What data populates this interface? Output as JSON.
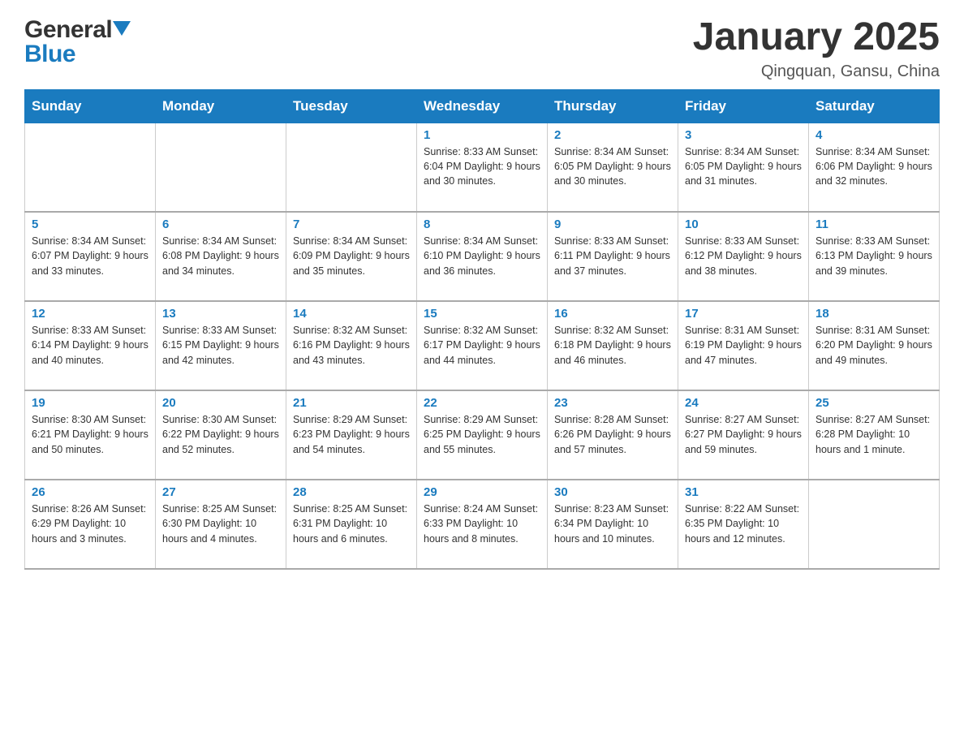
{
  "header": {
    "logo_general": "General",
    "logo_blue": "Blue",
    "title": "January 2025",
    "subtitle": "Qingquan, Gansu, China"
  },
  "days_of_week": [
    "Sunday",
    "Monday",
    "Tuesday",
    "Wednesday",
    "Thursday",
    "Friday",
    "Saturday"
  ],
  "weeks": [
    [
      {
        "day": "",
        "info": ""
      },
      {
        "day": "",
        "info": ""
      },
      {
        "day": "",
        "info": ""
      },
      {
        "day": "1",
        "info": "Sunrise: 8:33 AM\nSunset: 6:04 PM\nDaylight: 9 hours\nand 30 minutes."
      },
      {
        "day": "2",
        "info": "Sunrise: 8:34 AM\nSunset: 6:05 PM\nDaylight: 9 hours\nand 30 minutes."
      },
      {
        "day": "3",
        "info": "Sunrise: 8:34 AM\nSunset: 6:05 PM\nDaylight: 9 hours\nand 31 minutes."
      },
      {
        "day": "4",
        "info": "Sunrise: 8:34 AM\nSunset: 6:06 PM\nDaylight: 9 hours\nand 32 minutes."
      }
    ],
    [
      {
        "day": "5",
        "info": "Sunrise: 8:34 AM\nSunset: 6:07 PM\nDaylight: 9 hours\nand 33 minutes."
      },
      {
        "day": "6",
        "info": "Sunrise: 8:34 AM\nSunset: 6:08 PM\nDaylight: 9 hours\nand 34 minutes."
      },
      {
        "day": "7",
        "info": "Sunrise: 8:34 AM\nSunset: 6:09 PM\nDaylight: 9 hours\nand 35 minutes."
      },
      {
        "day": "8",
        "info": "Sunrise: 8:34 AM\nSunset: 6:10 PM\nDaylight: 9 hours\nand 36 minutes."
      },
      {
        "day": "9",
        "info": "Sunrise: 8:33 AM\nSunset: 6:11 PM\nDaylight: 9 hours\nand 37 minutes."
      },
      {
        "day": "10",
        "info": "Sunrise: 8:33 AM\nSunset: 6:12 PM\nDaylight: 9 hours\nand 38 minutes."
      },
      {
        "day": "11",
        "info": "Sunrise: 8:33 AM\nSunset: 6:13 PM\nDaylight: 9 hours\nand 39 minutes."
      }
    ],
    [
      {
        "day": "12",
        "info": "Sunrise: 8:33 AM\nSunset: 6:14 PM\nDaylight: 9 hours\nand 40 minutes."
      },
      {
        "day": "13",
        "info": "Sunrise: 8:33 AM\nSunset: 6:15 PM\nDaylight: 9 hours\nand 42 minutes."
      },
      {
        "day": "14",
        "info": "Sunrise: 8:32 AM\nSunset: 6:16 PM\nDaylight: 9 hours\nand 43 minutes."
      },
      {
        "day": "15",
        "info": "Sunrise: 8:32 AM\nSunset: 6:17 PM\nDaylight: 9 hours\nand 44 minutes."
      },
      {
        "day": "16",
        "info": "Sunrise: 8:32 AM\nSunset: 6:18 PM\nDaylight: 9 hours\nand 46 minutes."
      },
      {
        "day": "17",
        "info": "Sunrise: 8:31 AM\nSunset: 6:19 PM\nDaylight: 9 hours\nand 47 minutes."
      },
      {
        "day": "18",
        "info": "Sunrise: 8:31 AM\nSunset: 6:20 PM\nDaylight: 9 hours\nand 49 minutes."
      }
    ],
    [
      {
        "day": "19",
        "info": "Sunrise: 8:30 AM\nSunset: 6:21 PM\nDaylight: 9 hours\nand 50 minutes."
      },
      {
        "day": "20",
        "info": "Sunrise: 8:30 AM\nSunset: 6:22 PM\nDaylight: 9 hours\nand 52 minutes."
      },
      {
        "day": "21",
        "info": "Sunrise: 8:29 AM\nSunset: 6:23 PM\nDaylight: 9 hours\nand 54 minutes."
      },
      {
        "day": "22",
        "info": "Sunrise: 8:29 AM\nSunset: 6:25 PM\nDaylight: 9 hours\nand 55 minutes."
      },
      {
        "day": "23",
        "info": "Sunrise: 8:28 AM\nSunset: 6:26 PM\nDaylight: 9 hours\nand 57 minutes."
      },
      {
        "day": "24",
        "info": "Sunrise: 8:27 AM\nSunset: 6:27 PM\nDaylight: 9 hours\nand 59 minutes."
      },
      {
        "day": "25",
        "info": "Sunrise: 8:27 AM\nSunset: 6:28 PM\nDaylight: 10 hours\nand 1 minute."
      }
    ],
    [
      {
        "day": "26",
        "info": "Sunrise: 8:26 AM\nSunset: 6:29 PM\nDaylight: 10 hours\nand 3 minutes."
      },
      {
        "day": "27",
        "info": "Sunrise: 8:25 AM\nSunset: 6:30 PM\nDaylight: 10 hours\nand 4 minutes."
      },
      {
        "day": "28",
        "info": "Sunrise: 8:25 AM\nSunset: 6:31 PM\nDaylight: 10 hours\nand 6 minutes."
      },
      {
        "day": "29",
        "info": "Sunrise: 8:24 AM\nSunset: 6:33 PM\nDaylight: 10 hours\nand 8 minutes."
      },
      {
        "day": "30",
        "info": "Sunrise: 8:23 AM\nSunset: 6:34 PM\nDaylight: 10 hours\nand 10 minutes."
      },
      {
        "day": "31",
        "info": "Sunrise: 8:22 AM\nSunset: 6:35 PM\nDaylight: 10 hours\nand 12 minutes."
      },
      {
        "day": "",
        "info": ""
      }
    ]
  ]
}
